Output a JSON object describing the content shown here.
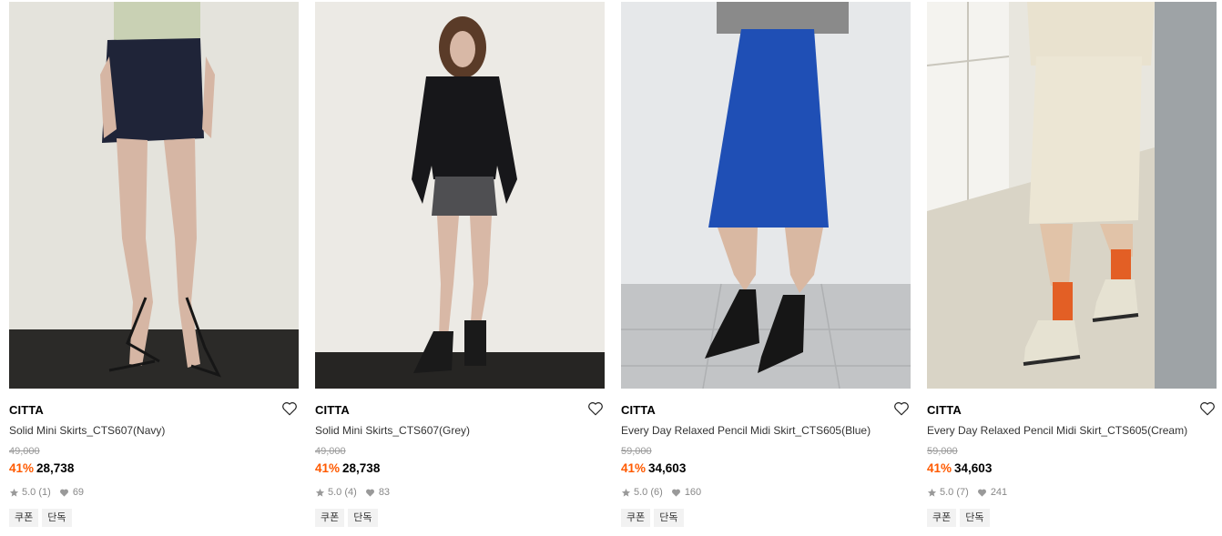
{
  "products": [
    {
      "brand": "CITTA",
      "name": "Solid Mini Skirts_CTS607(Navy)",
      "original_price": "49,000",
      "discount": "41%",
      "price": "28,738",
      "rating": "5.0",
      "review_count": "(1)",
      "likes": "69",
      "tags": [
        "쿠폰",
        "단독"
      ],
      "image": {
        "description": "model in navy mini skirt with strappy sandals",
        "colors": {
          "bg": "#e4e3dc",
          "floor": "#2b2a28",
          "garment": "#1f2438",
          "skin": "#d6b6a4",
          "top": "#c9d1b4"
        }
      }
    },
    {
      "brand": "CITTA",
      "name": "Solid Mini Skirts_CTS607(Grey)",
      "original_price": "49,000",
      "discount": "41%",
      "price": "28,738",
      "rating": "5.0",
      "review_count": "(4)",
      "likes": "83",
      "tags": [
        "쿠폰",
        "단독"
      ],
      "image": {
        "description": "model in black top and grey mini skirt with boots",
        "colors": {
          "bg": "#eceae5",
          "floor": "#262523",
          "garment": "#4f4f52",
          "skin": "#d8b8a6",
          "top": "#17171a"
        }
      }
    },
    {
      "brand": "CITTA",
      "name": "Every Day Relaxed Pencil Midi Skirt_CTS605(Blue)",
      "original_price": "59,000",
      "discount": "41%",
      "price": "34,603",
      "rating": "5.0",
      "review_count": "(6)",
      "likes": "160",
      "tags": [
        "쿠폰",
        "단독"
      ],
      "image": {
        "description": "model in blue midi pencil skirt with black flats",
        "colors": {
          "bg": "#e6e8ea",
          "floor": "#c2c4c6",
          "garment": "#1f4fb5",
          "skin": "#d9b8a2",
          "top": "#8a8a8a"
        }
      }
    },
    {
      "brand": "CITTA",
      "name": "Every Day Relaxed Pencil Midi Skirt_CTS605(Cream)",
      "original_price": "59,000",
      "discount": "41%",
      "price": "34,603",
      "rating": "5.0",
      "review_count": "(7)",
      "likes": "241",
      "tags": [
        "쿠폰",
        "단독"
      ],
      "image": {
        "description": "model in cream midi skirt with orange socks and sneakers",
        "colors": {
          "bg": "#e8e6de",
          "floor": "#d9d4c6",
          "garment": "#ece6d4",
          "skin": "#e1c3a8",
          "top": "#e9e2cf"
        }
      }
    }
  ],
  "colors": {
    "discount": "#ff5a00",
    "muted": "#999999",
    "tag_bg": "#f2f2f2"
  },
  "icons": {
    "wishlist": "heart-outline-icon",
    "rating": "star-icon",
    "likes": "heart-icon"
  }
}
